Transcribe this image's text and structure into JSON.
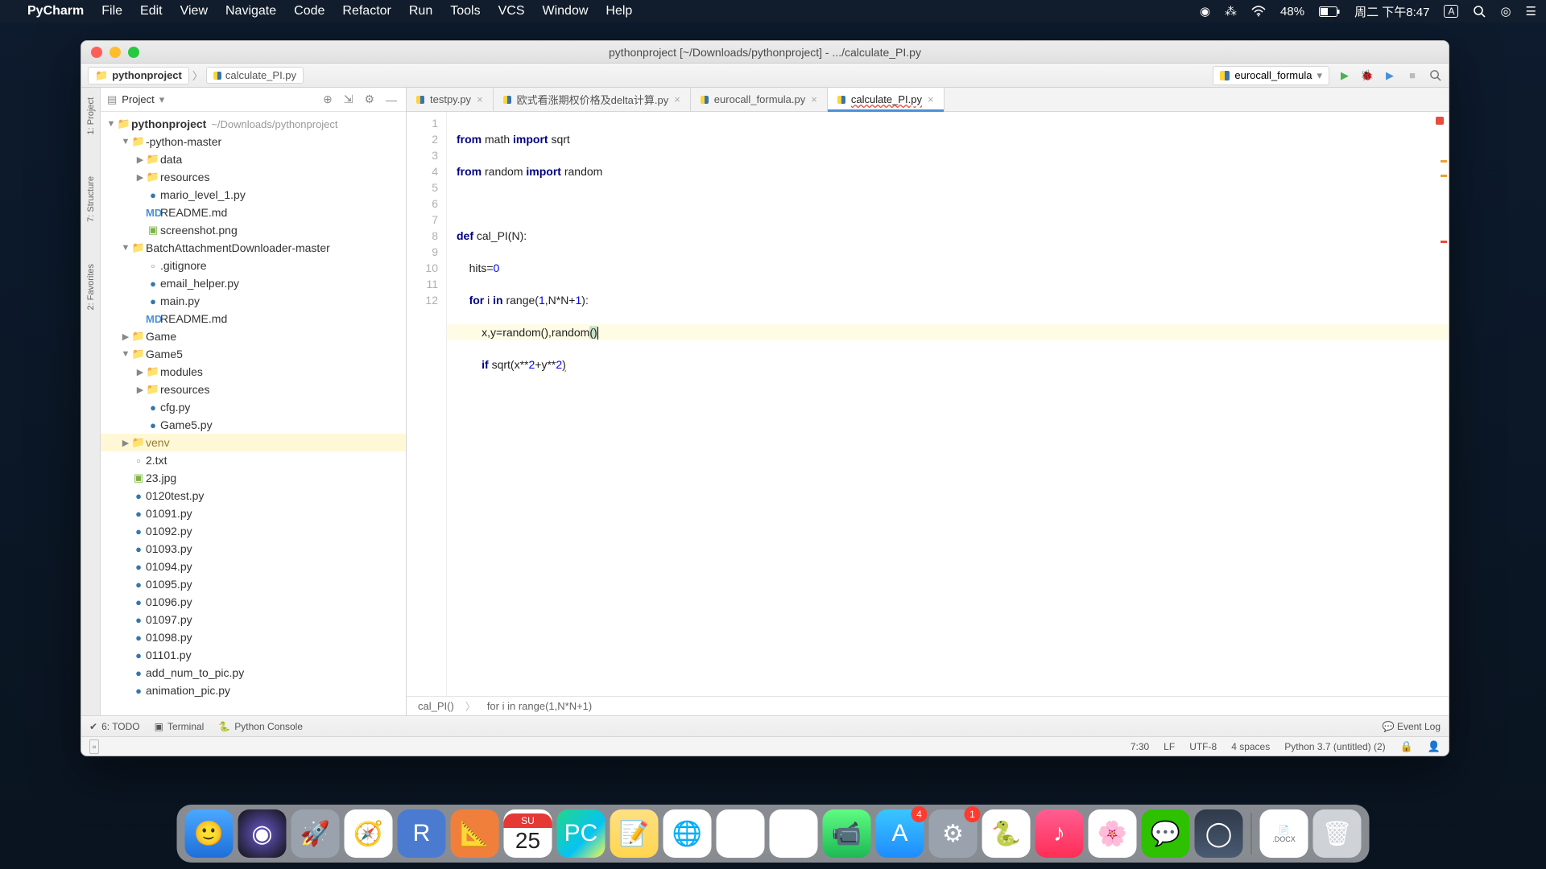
{
  "menubar": {
    "app": "PyCharm",
    "items": [
      "File",
      "Edit",
      "View",
      "Navigate",
      "Code",
      "Refactor",
      "Run",
      "Tools",
      "VCS",
      "Window",
      "Help"
    ],
    "battery": "48%",
    "clock": "周二 下午8:47",
    "ime": "A"
  },
  "window": {
    "title": "pythonproject [~/Downloads/pythonproject] - .../calculate_PI.py"
  },
  "breadcrumb": {
    "project": "pythonproject",
    "file": "calculate_PI.py"
  },
  "runconfig": {
    "name": "eurocall_formula"
  },
  "toolstrip": {
    "project": "1: Project",
    "structure": "7: Structure",
    "favorites": "2: Favorites"
  },
  "project_panel": {
    "title": "Project"
  },
  "tree": {
    "root": {
      "name": "pythonproject",
      "path": "~/Downloads/pythonproject"
    },
    "python_master": "-python-master",
    "data": "data",
    "resources": "resources",
    "mario": "mario_level_1.py",
    "readme1": "README.md",
    "screenshot": "screenshot.png",
    "batch": "BatchAttachmentDownloader-master",
    "gitignore": ".gitignore",
    "email_helper": "email_helper.py",
    "mainpy": "main.py",
    "readme2": "README.md",
    "game": "Game",
    "game5": "Game5",
    "modules": "modules",
    "resources2": "resources",
    "cfg": "cfg.py",
    "game5py": "Game5.py",
    "venv": "venv",
    "f2txt": "2.txt",
    "f23jpg": "23.jpg",
    "f0120": "0120test.py",
    "f01091": "01091.py",
    "f01092": "01092.py",
    "f01093": "01093.py",
    "f01094": "01094.py",
    "f01095": "01095.py",
    "f01096": "01096.py",
    "f01097": "01097.py",
    "f01098": "01098.py",
    "f01101": "01101.py",
    "addnum": "add_num_to_pic.py",
    "anim": "animation_pic.py"
  },
  "tabs": {
    "t1": "testpy.py",
    "t2": "欧式看涨期权价格及delta计算.py",
    "t3": "eurocall_formula.py",
    "t4": "calculate_PI.py"
  },
  "code": {
    "l1a": "from",
    "l1b": "math",
    "l1c": "import",
    "l1d": "sqrt",
    "l2a": "from",
    "l2b": "random",
    "l2c": "import",
    "l2d": "random",
    "l4a": "def",
    "l4b": "cal_PI(N):",
    "l5a": "hits=",
    "l5b": "0",
    "l6a": "for",
    "l6b": "i",
    "l6c": "in",
    "l6d": "range(",
    "l6e": "1",
    "l6f": ",N*N+",
    "l6g": "1",
    "l6h": "):",
    "l7a": "x,y=random(),random",
    "l7b": "(",
    "l7c": ")",
    "l8a": "if",
    "l8b": "sqrt(x**",
    "l8c": "2",
    "l8d": "+y**",
    "l8e": "2",
    "l8f": ")"
  },
  "line_numbers": [
    "1",
    "2",
    "3",
    "4",
    "5",
    "6",
    "7",
    "8",
    "9",
    "10",
    "11",
    "12"
  ],
  "editor_breadcrumb": {
    "a": "cal_PI()",
    "b": "for i in range(1,N*N+1)"
  },
  "bottom": {
    "todo": "6: TODO",
    "terminal": "Terminal",
    "console": "Python Console",
    "eventlog": "Event Log"
  },
  "status": {
    "pos": "7:30",
    "lf": "LF",
    "enc": "UTF-8",
    "indent": "4 spaces",
    "interp": "Python 3.7 (untitled) (2)"
  },
  "dock": {
    "cal_dow": "SU",
    "cal_day": "25",
    "badge_appstore": "4",
    "badge_settings": "1",
    "docx_label": ".DOCX"
  }
}
